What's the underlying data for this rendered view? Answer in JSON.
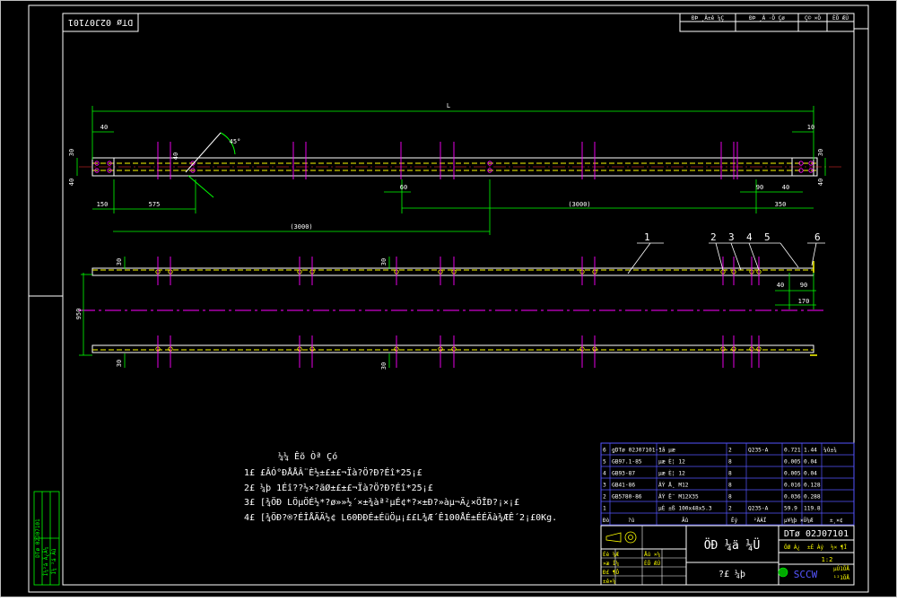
{
  "drawing": {
    "code_top": "DTø 02J07101",
    "code_box": "DTø 02J07101",
    "title": "ÖÐ ¼ä ¼Ü",
    "subtitle": "?£ ¼þ",
    "scale": "1:2",
    "company": "SCCW",
    "sheet": "µÚ1ÕÅ",
    "total": "¹²1ÕÅ"
  },
  "top_table": [
    "ÐÞ ¸Ä±ê ¼Ç",
    "ÐÞ ¸Ä ·Ö Çø",
    "Ç© ×Ö",
    "ÈÕ ÆÚ"
  ],
  "dims_plan": {
    "L": "L",
    "d40": "40",
    "d30": "30",
    "d40b": "40",
    "d45": "45°",
    "d40c": "40",
    "d150": "150",
    "d575": "575",
    "d3000a": "(3000)",
    "d60": "60",
    "d3000b": "(3000)",
    "d90": "90",
    "d40d": "40",
    "d350": "350",
    "d10": "10",
    "d30r": "30",
    "d40r": "40"
  },
  "dims_elev": {
    "d30a": "30",
    "d30b": "30",
    "d950": "950",
    "d40": "40",
    "d90": "90",
    "d170": "170",
    "d30c": "30",
    "d30d": "30"
  },
  "callouts": [
    "1",
    "2",
    "3",
    "4",
    "5",
    "6"
  ],
  "notes": {
    "heading": "¼¼ Êõ Òª Çó",
    "lines": [
      "1£ £ÂÓ°ÐÅÅÂ¨È½±£±£¬Ïà?Ö?Ð?Éî*25¡£",
      "2£ ¼þ 1Éî??½×?ãØ±£±£¬Ïà?Ö?Ð?Éî*25¡£",
      "3£ [¾ÖÐ LÖµÖÉ½*?ø»»½´×±¾àª²µÉ¢*?×±Ð?»àµ¬Ä¿×ÖÎÐ?¡×¡£",
      "4£ [¾ÖÐ?®?ÉÎÅÄÄ½¢ L60ÐÐÉ±ÉüÖµ¡££L¾Æ´Ê100ÅÉ±ÉÉÄà¾ÆÊ´2¡£0Kg."
    ]
  },
  "side_strip": [
    "DTø 02J07101",
    "Í¼²á Ä¿Â¼",
    "Í¼ ²á Ãû"
  ],
  "parts": [
    {
      "no": "6",
      "code": "gDTø 02J07101-1",
      "name": "°å µæ",
      "qty": "2",
      "mat": "Q235-A",
      "w1": "0.721",
      "w2": "1.44",
      "note": "¼û±¾"
    },
    {
      "no": "5",
      "code": "GB97.1-85",
      "name": "µæ È¦ 12",
      "qty": "8",
      "mat": "",
      "w1": "0.005",
      "w2": "0.04",
      "note": ""
    },
    {
      "no": "4",
      "code": "GB93-87",
      "name": "µæ È¦ 12",
      "qty": "8",
      "mat": "",
      "w1": "0.005",
      "w2": "0.04",
      "note": ""
    },
    {
      "no": "3",
      "code": "GB41-86",
      "name": "ÂÝ Ä¸ M12",
      "qty": "8",
      "mat": "",
      "w1": "0.016",
      "w2": "0.128",
      "note": ""
    },
    {
      "no": "2",
      "code": "GB5780-86",
      "name": "ÂÝ Ë¨ M12X35",
      "qty": "8",
      "mat": "",
      "w1": "0.036",
      "w2": "0.288",
      "note": ""
    },
    {
      "no": "1",
      "code": "",
      "name": "µÈ ±ß 100x48x5.3",
      "qty": "2",
      "mat": "Q235-A",
      "w1": "59.9",
      "w2": "119.8",
      "note": ""
    }
  ],
  "parts_header": {
    "no": "Ðò",
    "code": "?ú",
    "name": "Ãû",
    "qty": "Êý",
    "mat": "²ÄÁÏ",
    "w": "µ¥¼þ ×Ü¼Æ",
    "note": "±¸×¢"
  },
  "title_small": {
    "design": "Éè ¼Æ",
    "draw": "»æ Í¼",
    "check": "Ð£ ¶Ô",
    "std": "±ê×¼",
    "approve": "Åú ×¼",
    "date": "ÈÕ ÆÚ",
    "mass": "ÖØ Á¿",
    "ratio": "±È Àý",
    "stage": "½× ¶Î"
  },
  "colors": {
    "bg": "#000000",
    "frame": "#ffffff",
    "green": "#00ff00",
    "yellow": "#ffff00",
    "magenta": "#ff00ff",
    "blue": "#5555ff",
    "red": "#ff3333",
    "cyan": "#00ffff"
  }
}
